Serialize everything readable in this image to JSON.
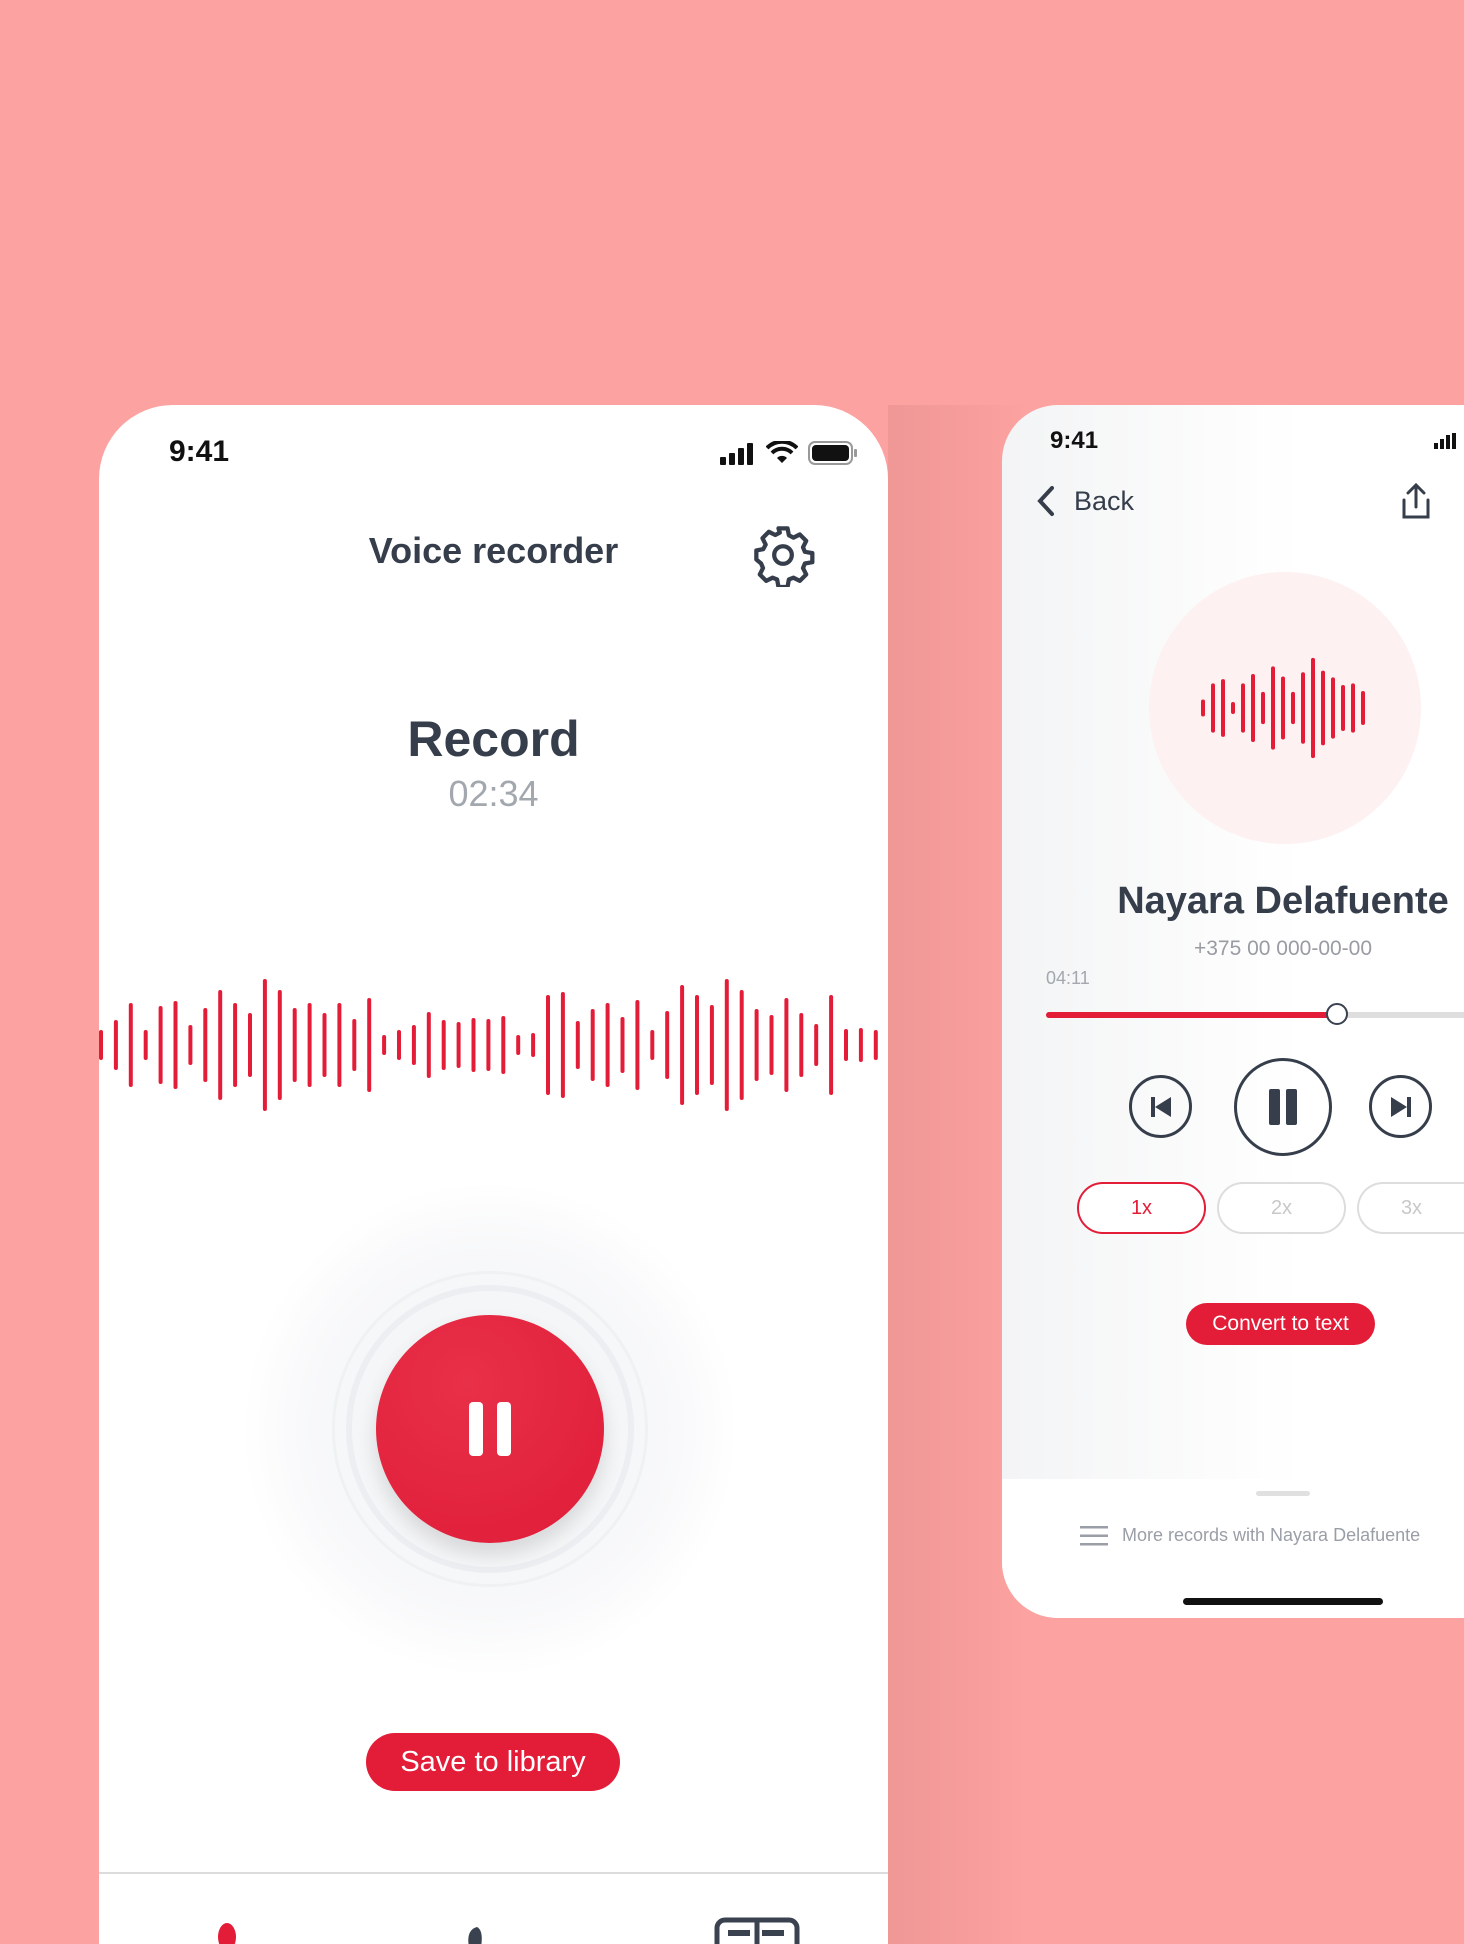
{
  "colors": {
    "accent": "#e31c38",
    "background": "#fca2a0",
    "text": "#363e4c",
    "muted": "#a3a7ae"
  },
  "recorder": {
    "status_time": "9:41",
    "title": "Voice recorder",
    "settings_icon": "gear-icon",
    "record_label": "Record",
    "duration": "02:34",
    "pause_icon": "pause-icon",
    "save_label": "Save to library",
    "nav": [
      {
        "icon": "microphone-icon",
        "active": true
      },
      {
        "icon": "phone-icon",
        "active": false
      },
      {
        "icon": "library-icon",
        "active": false
      }
    ]
  },
  "player": {
    "status_time": "9:41",
    "back_label": "Back",
    "share_icon": "share-icon",
    "contact_name": "Nayara Delafuente",
    "contact_phone": "+375 00 000-00-00",
    "elapsed": "04:11",
    "progress": 0.56,
    "speeds": [
      {
        "label": "1x",
        "selected": true
      },
      {
        "label": "2x",
        "selected": false
      },
      {
        "label": "3x",
        "selected": false
      }
    ],
    "convert_label": "Convert to text",
    "more_records": "More records with Nayara Delafuente"
  }
}
